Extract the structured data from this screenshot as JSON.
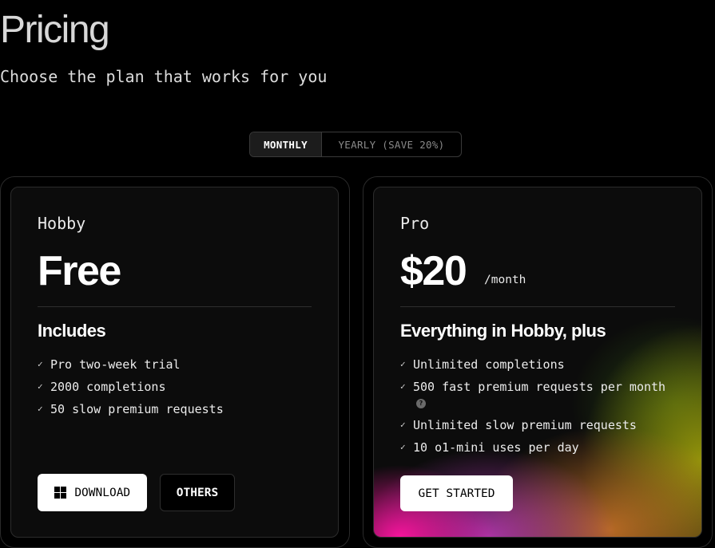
{
  "header": {
    "title": "Pricing",
    "subtitle": "Choose the plan that works for you"
  },
  "billing_toggle": {
    "options": [
      {
        "label": "MONTHLY",
        "active": true
      },
      {
        "label": "YEARLY (SAVE 20%)",
        "active": false
      }
    ]
  },
  "plans": [
    {
      "name": "Hobby",
      "price": "Free",
      "features_heading": "Includes",
      "features": [
        "Pro two-week trial",
        "2000 completions",
        "50 slow premium requests"
      ],
      "buttons": {
        "download": "DOWNLOAD",
        "others": "OTHERS"
      }
    },
    {
      "name": "Pro",
      "price": "$20",
      "period": "/month",
      "features_heading": "Everything in Hobby, plus",
      "features": [
        "Unlimited completions",
        "500 fast premium requests per month",
        "Unlimited slow premium requests",
        "10 o1-mini uses per day"
      ],
      "cta": "GET STARTED"
    }
  ],
  "icons": {
    "check": "check-icon",
    "help": "help-icon",
    "download": "windows-icon"
  },
  "colors": {
    "background": "#000000",
    "card": "#0c0c0c",
    "border": "#2c2c2c",
    "accent_gradient": [
      "#ff14a0",
      "#c83cc8",
      "#d27828",
      "#a0a00a"
    ]
  }
}
